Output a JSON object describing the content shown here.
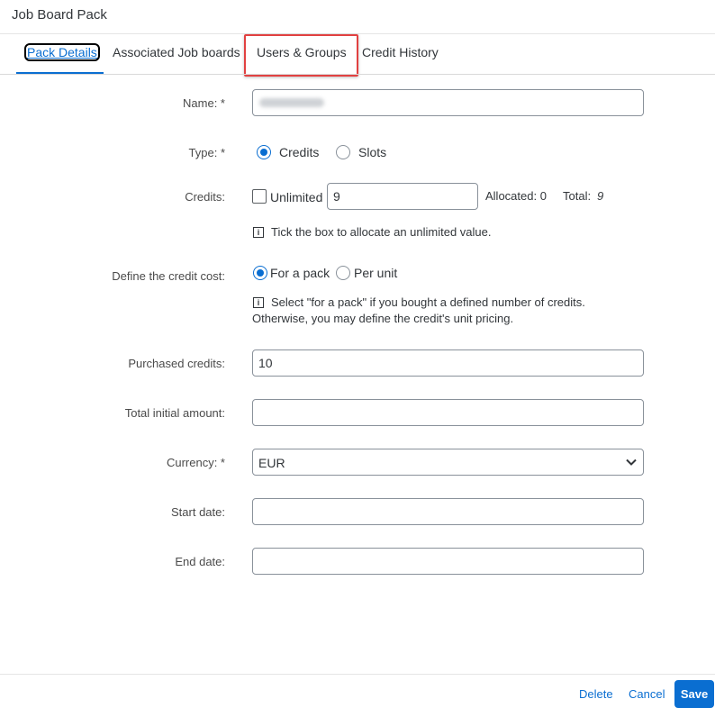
{
  "dialog": {
    "title": "Job Board Pack"
  },
  "tabs": [
    {
      "label": "Pack Details"
    },
    {
      "label": "Associated Job boards"
    },
    {
      "label": "Users & Groups"
    },
    {
      "label": "Credit History"
    }
  ],
  "form": {
    "name_label": "Name: *",
    "name_value": "",
    "type_label": "Type: *",
    "type_options": [
      "Credits",
      "Slots"
    ],
    "type_selected": "Credits",
    "credits_label": "Credits:",
    "unlimited_label": "Unlimited",
    "credits_value": "9",
    "allocated_text": "Allocated: 0",
    "total_label": "Total:",
    "total_value": "9",
    "credits_hint": "Tick the box to allocate an unlimited value.",
    "credit_cost_label": "Define the credit cost:",
    "credit_cost_options": [
      "For a pack",
      "Per unit"
    ],
    "credit_cost_selected": "For a pack",
    "credit_cost_hint_line1": "Select \"for a pack\" if you bought a defined number of credits.",
    "credit_cost_hint_line2": "Otherwise, you may define the credit's unit pricing.",
    "purchased_label": "Purchased credits:",
    "purchased_value": "10",
    "amount_label": "Total initial amount:",
    "amount_value": "",
    "currency_label": "Currency: *",
    "currency_value": "EUR",
    "start_label": "Start date:",
    "start_value": "",
    "end_label": "End date:",
    "end_value": ""
  },
  "footer": {
    "delete_label": "Delete",
    "cancel_label": "Cancel",
    "save_label": "Save"
  },
  "colors": {
    "accent": "#0a6ed1",
    "highlight": "#e14141"
  },
  "icons": {
    "info": "info-icon",
    "dropdown": "chevron-down-icon"
  }
}
